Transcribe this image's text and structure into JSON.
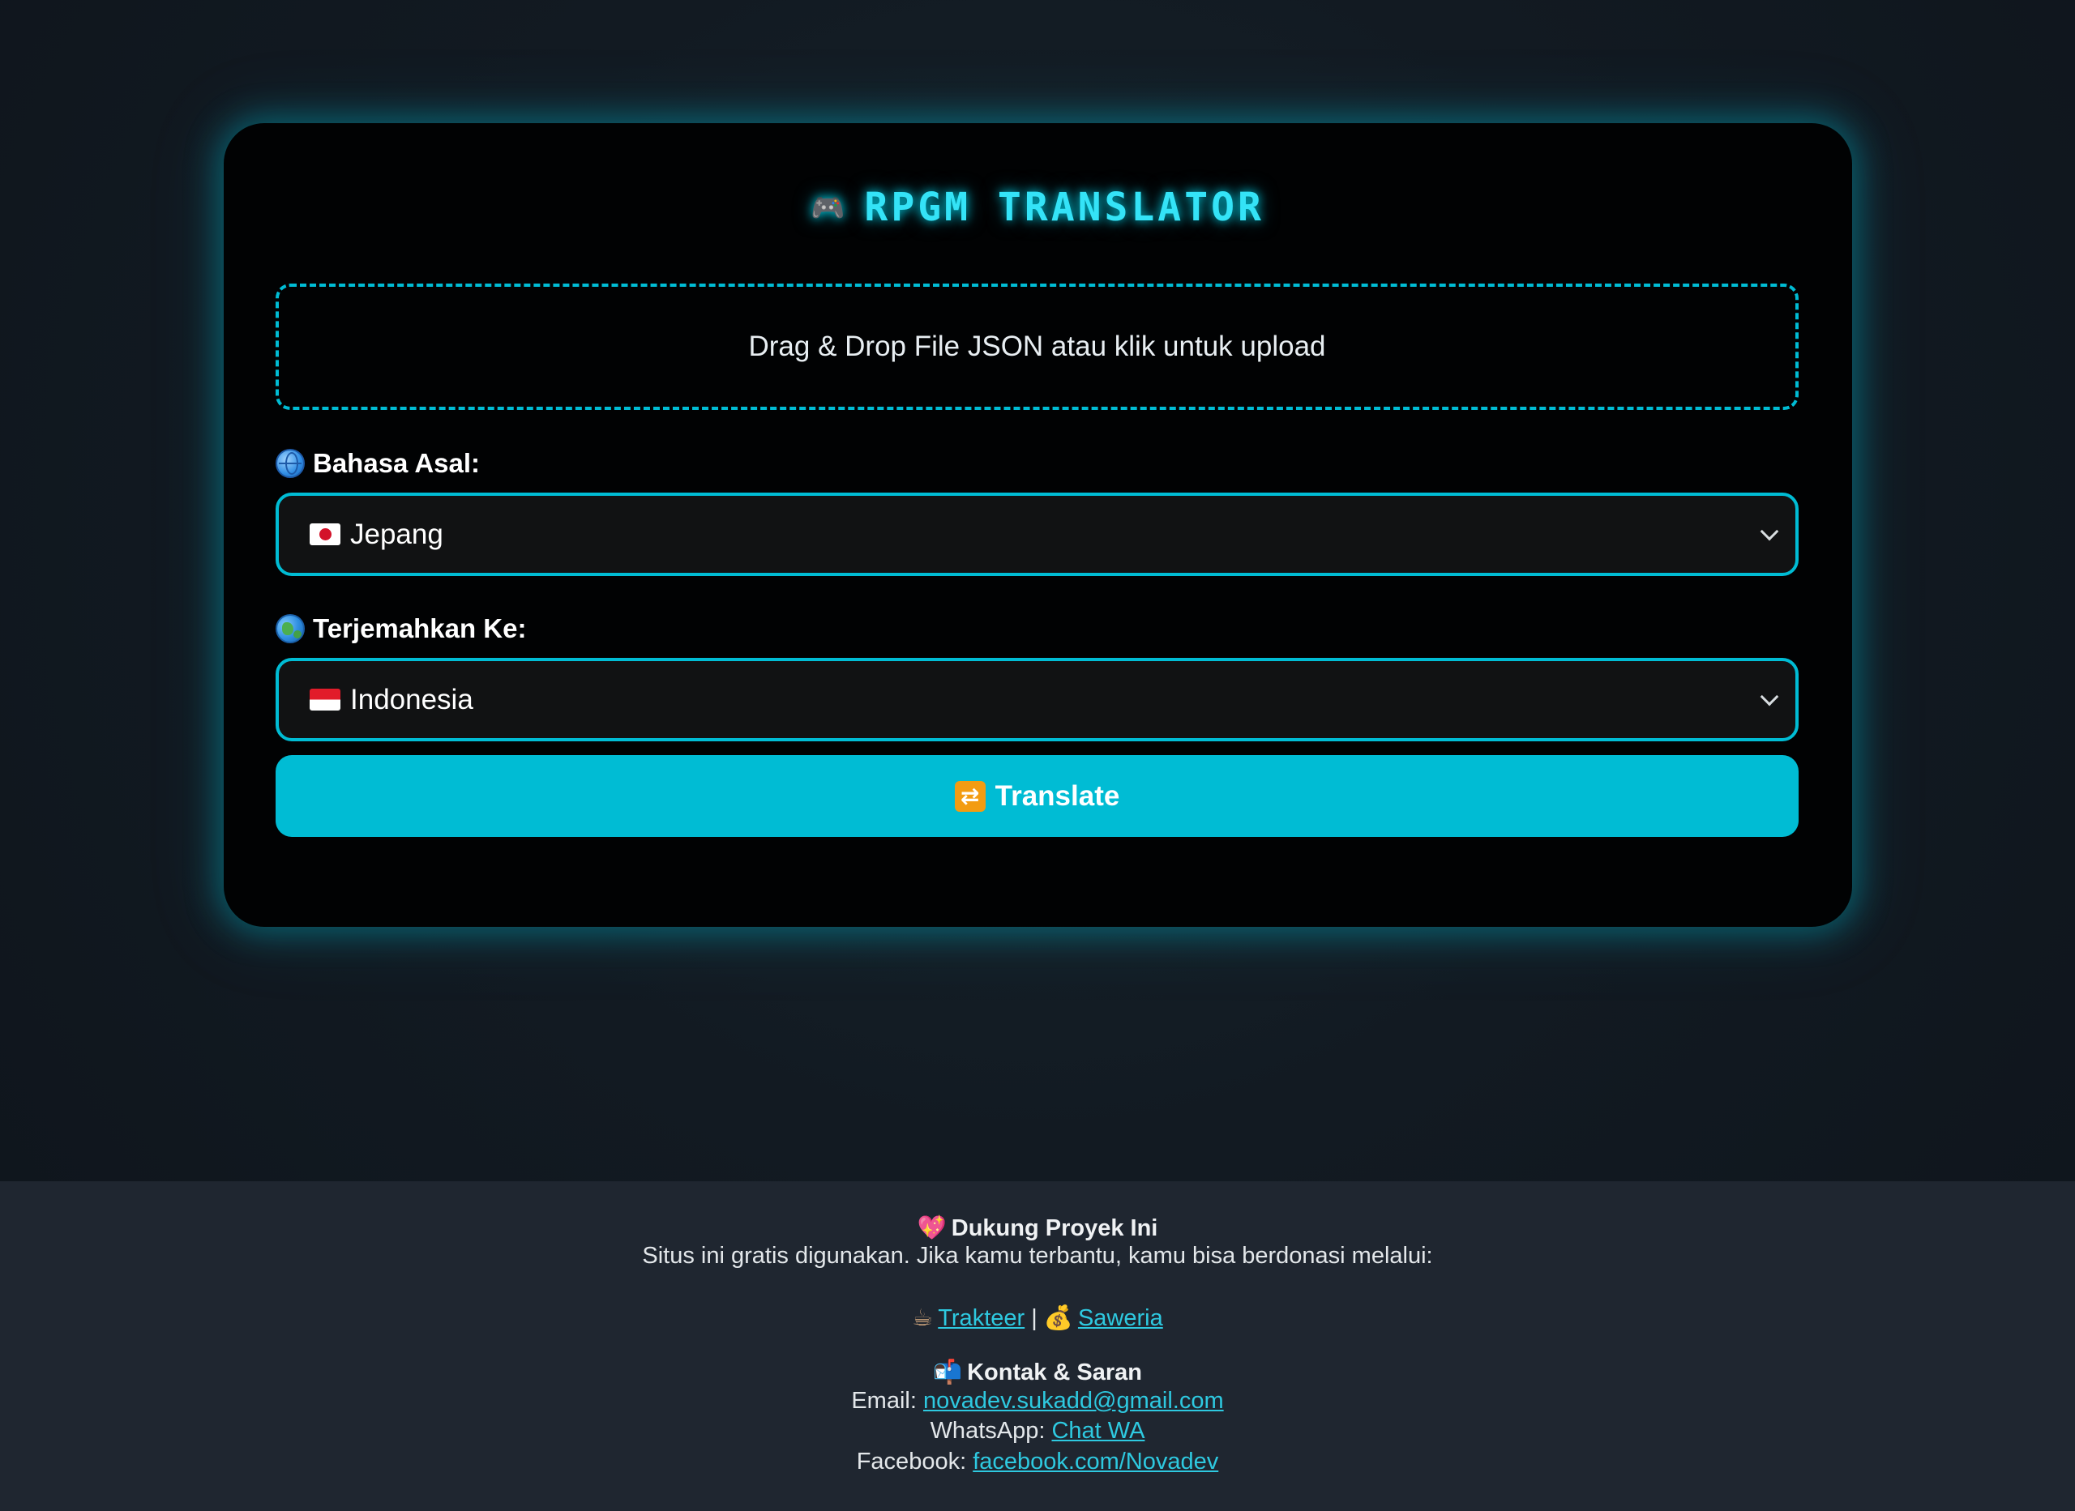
{
  "app": {
    "title": "RPGM TRANSLATOR",
    "title_icon": "gamepad-icon"
  },
  "upload": {
    "text": "Drag & Drop File JSON atau klik untuk upload"
  },
  "source_language": {
    "label": "Bahasa Asal:",
    "icon": "globe-icon",
    "selected": "Jepang",
    "flag": "flag-japan"
  },
  "target_language": {
    "label": "Terjemahkan Ke:",
    "icon": "earth-globe-icon",
    "selected": "Indonesia",
    "flag": "flag-indonesia"
  },
  "translate_button": {
    "label": "Translate",
    "icon": "repeat-icon"
  },
  "footer": {
    "support_title": "Dukung Proyek Ini",
    "support_text": "Situs ini gratis digunakan. Jika kamu terbantu, kamu bisa berdonasi melalui:",
    "donate_links": [
      {
        "label": "Trakteer",
        "icon": "coffee-icon"
      },
      {
        "label": "Saweria",
        "icon": "money-bag-icon"
      }
    ],
    "separator": "|",
    "contact_title": "Kontak & Saran",
    "email_label": "Email:",
    "email_value": "novadev.sukadd@gmail.com",
    "whatsapp_label": "WhatsApp:",
    "whatsapp_value": "Chat WA",
    "facebook_label": "Facebook:",
    "facebook_value": "facebook.com/Novadev"
  },
  "colors": {
    "accent": "#00bcd4",
    "title_glow": "#34e3f7",
    "card_bg": "#010203",
    "footer_bg": "#1f2630",
    "link": "#2ec9e0"
  }
}
